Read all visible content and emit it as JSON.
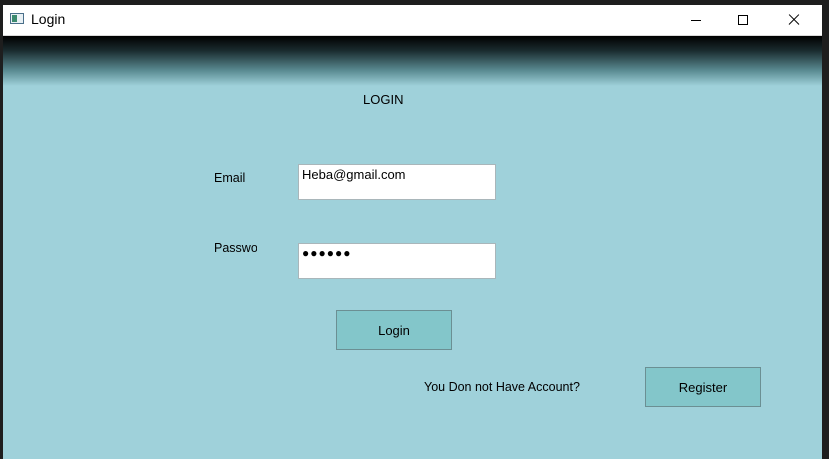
{
  "window": {
    "title": "Login",
    "icon": "app-window-icon"
  },
  "form": {
    "heading": "LOGIN",
    "email_label": "Email",
    "email_value": "Heba@gmail.com",
    "password_label": "Passwor",
    "password_value": "●●●●●●",
    "login_button": "Login"
  },
  "footer": {
    "prompt": "You Don not Have Account?",
    "register_button": "Register"
  },
  "colors": {
    "background": "#9fd1da",
    "button": "#83c6ca"
  }
}
